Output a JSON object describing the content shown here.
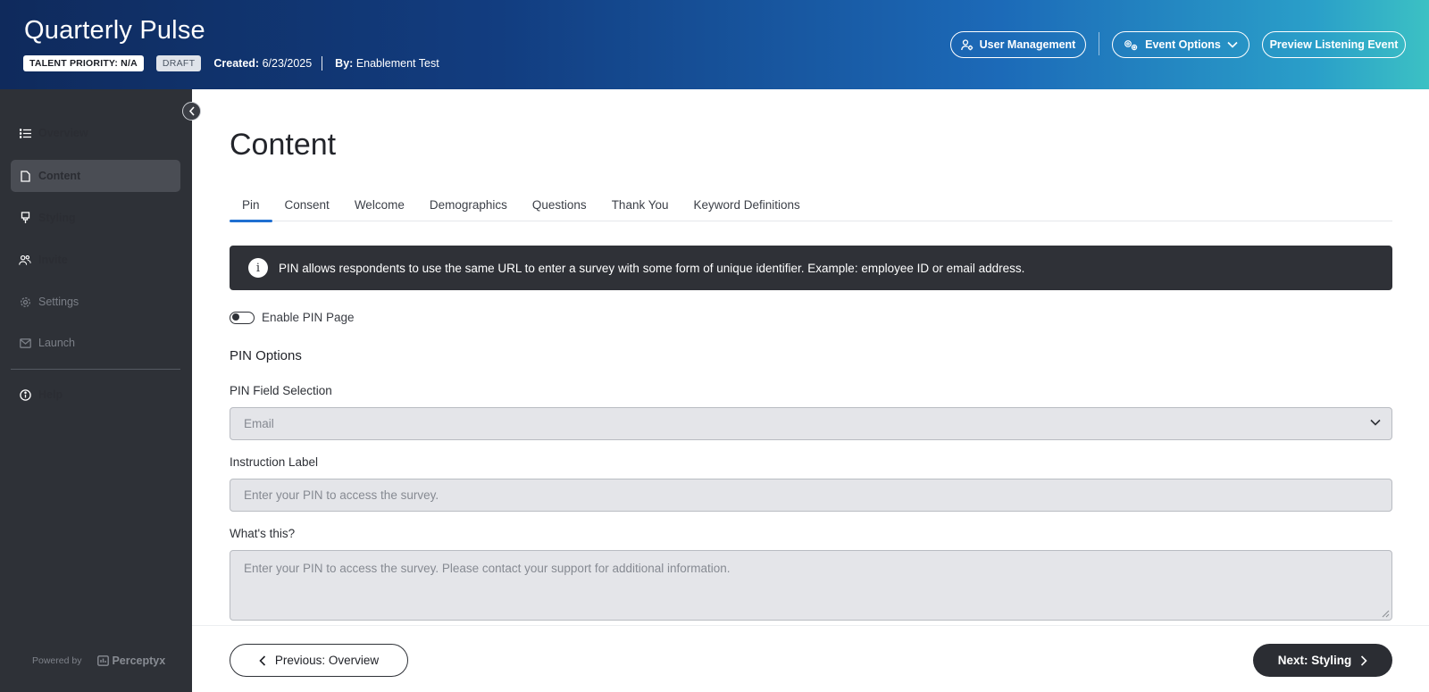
{
  "header": {
    "title": "Quarterly Pulse",
    "talent_priority": "TALENT PRIORITY: N/A",
    "status": "DRAFT",
    "created_label": "Created:",
    "created_value": "6/23/2025",
    "by_label": "By:",
    "by_value": "Enablement Test",
    "user_management": "User Management",
    "event_options": "Event Options",
    "preview": "Preview Listening Event"
  },
  "sidebar": {
    "items": [
      {
        "label": "Overview",
        "icon": "list-icon"
      },
      {
        "label": "Content",
        "icon": "document-icon",
        "active": true
      },
      {
        "label": "Styling",
        "icon": "brush-icon"
      },
      {
        "label": "Invite",
        "icon": "users-icon"
      },
      {
        "label": "Settings",
        "icon": "gear-icon",
        "disabled": true
      },
      {
        "label": "Launch",
        "icon": "mail-icon",
        "disabled": true
      },
      {
        "label": "Help",
        "icon": "info-icon"
      }
    ],
    "powered_by": "Powered by",
    "brand": "Perceptyx"
  },
  "main": {
    "title": "Content",
    "tabs": [
      "Pin",
      "Consent",
      "Welcome",
      "Demographics",
      "Questions",
      "Thank You",
      "Keyword Definitions"
    ],
    "active_tab": "Pin",
    "info_text": "PIN allows respondents to use the same URL to enter a survey with some form of unique identifier. Example: employee ID or email address.",
    "enable_pin_label": "Enable PIN Page",
    "enable_pin_on": false,
    "pin_options_title": "PIN Options",
    "pin_field_label": "PIN Field Selection",
    "pin_field_value": "Email",
    "instruction_label": "Instruction Label",
    "instruction_value": "Enter your PIN to access the survey.",
    "whats_this_label": "What's this?",
    "whats_this_value": "Enter your PIN to access the survey. Please contact your support for additional information."
  },
  "footer": {
    "prev": "Previous: Overview",
    "next": "Next: Styling"
  },
  "colors": {
    "accent": "#1f6fd1",
    "sidebar_bg": "#2e3137",
    "banner_bg": "#2f3137"
  }
}
